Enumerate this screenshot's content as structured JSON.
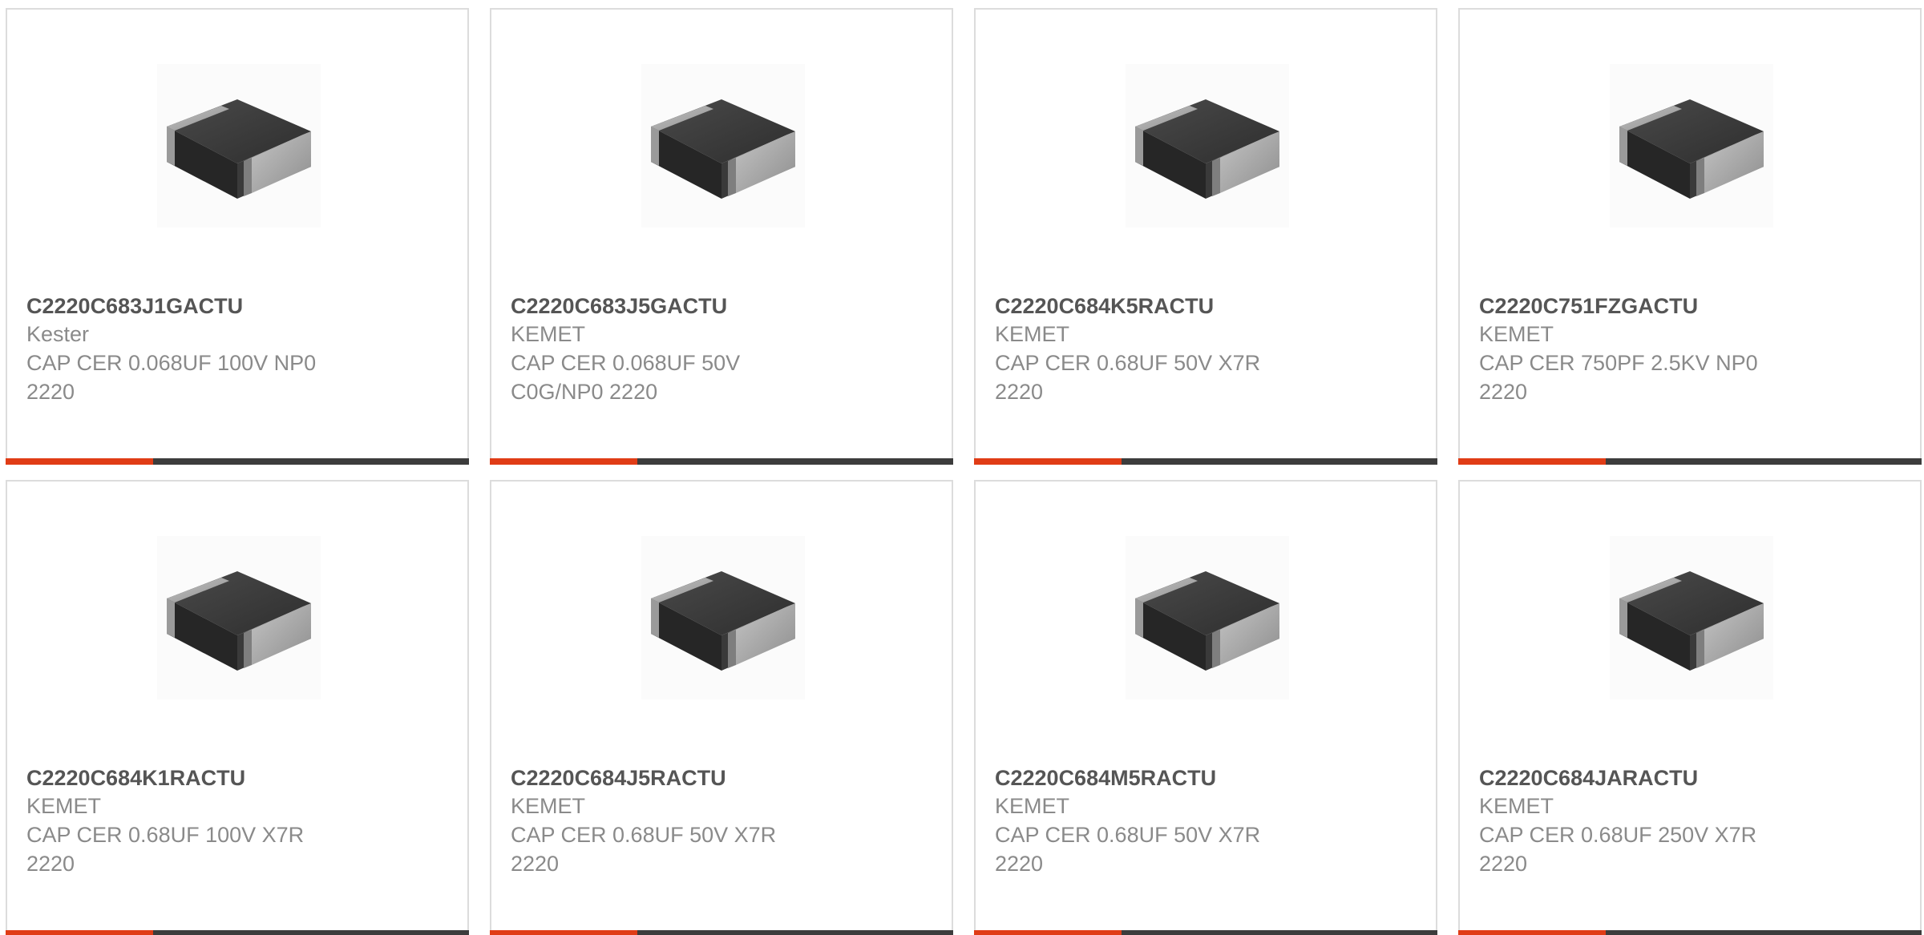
{
  "colors": {
    "accent": "#e03c16",
    "bar": "#3c3c3c",
    "border": "#dcdcdc",
    "part_text": "#555555",
    "secondary_text": "#8a8a8a"
  },
  "products": [
    {
      "part": "C2220C683J1GACTU",
      "manufacturer": "Kester",
      "description": "CAP CER 0.068UF 100V NP0 2220",
      "image_icon": "capacitor-chip-icon"
    },
    {
      "part": "C2220C683J5GACTU",
      "manufacturer": "KEMET",
      "description": "CAP CER 0.068UF 50V C0G/NP0 2220",
      "image_icon": "capacitor-chip-icon"
    },
    {
      "part": "C2220C684K5RACTU",
      "manufacturer": "KEMET",
      "description": "CAP CER 0.68UF 50V X7R 2220",
      "image_icon": "capacitor-chip-icon"
    },
    {
      "part": "C2220C751FZGACTU",
      "manufacturer": "KEMET",
      "description": "CAP CER 750PF 2.5KV NP0 2220",
      "image_icon": "capacitor-chip-icon"
    },
    {
      "part": "C2220C684K1RACTU",
      "manufacturer": "KEMET",
      "description": "CAP CER 0.68UF 100V X7R 2220",
      "image_icon": "capacitor-chip-icon"
    },
    {
      "part": "C2220C684J5RACTU",
      "manufacturer": "KEMET",
      "description": "CAP CER 0.68UF 50V X7R 2220",
      "image_icon": "capacitor-chip-icon"
    },
    {
      "part": "C2220C684M5RACTU",
      "manufacturer": "KEMET",
      "description": "CAP CER 0.68UF 50V X7R 2220",
      "image_icon": "capacitor-chip-icon"
    },
    {
      "part": "C2220C684JARACTU",
      "manufacturer": "KEMET",
      "description": "CAP CER 0.68UF 250V X7R 2220",
      "image_icon": "capacitor-chip-icon"
    }
  ]
}
